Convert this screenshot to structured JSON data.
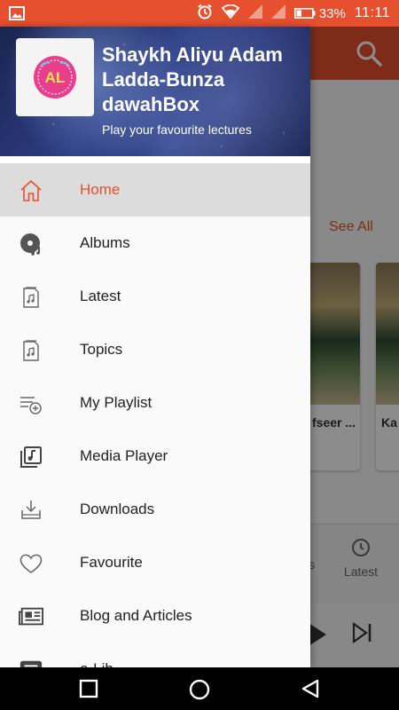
{
  "status_bar": {
    "battery": "33%",
    "time": "11:11"
  },
  "background": {
    "see_all": "See All",
    "cards": [
      {
        "caption": "fseer ..."
      },
      {
        "caption": "Ka"
      }
    ],
    "tab_partial": "s",
    "tab_latest": "Latest"
  },
  "drawer": {
    "logo_text": "AL",
    "title": "Shaykh Aliyu Adam Ladda-Bunza dawahBox",
    "subtitle": "Play your favourite lectures",
    "items": [
      {
        "label": "Home",
        "icon": "home-icon"
      },
      {
        "label": "Albums",
        "icon": "disc-icon"
      },
      {
        "label": "Latest",
        "icon": "music-file-icon"
      },
      {
        "label": "Topics",
        "icon": "music-file-icon"
      },
      {
        "label": "My Playlist",
        "icon": "playlist-add-icon"
      },
      {
        "label": "Media Player",
        "icon": "media-library-icon"
      },
      {
        "label": "Downloads",
        "icon": "download-icon"
      },
      {
        "label": "Favourite",
        "icon": "heart-icon"
      },
      {
        "label": "Blog and Articles",
        "icon": "newspaper-icon"
      },
      {
        "label": "e-Lib",
        "icon": "book-icon"
      }
    ]
  },
  "colors": {
    "accent": "#e6502e",
    "active_bg": "#dcdcdc"
  }
}
